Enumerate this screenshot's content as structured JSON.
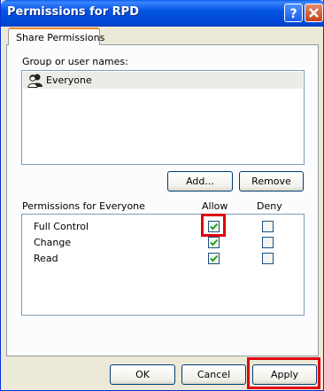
{
  "window": {
    "title": "Permissions for RPD",
    "help_icon": "question-icon",
    "close_icon": "close-icon"
  },
  "tab": {
    "label": "Share Permissions"
  },
  "group_section": {
    "label": "Group or user names:",
    "items": [
      {
        "name": "Everyone",
        "icon": "users-group-icon",
        "selected": true
      }
    ]
  },
  "buttons": {
    "add": "Add...",
    "remove": "Remove",
    "ok": "OK",
    "cancel": "Cancel",
    "apply": "Apply"
  },
  "permissions": {
    "label": "Permissions for Everyone",
    "allow_header": "Allow",
    "deny_header": "Deny",
    "rows": [
      {
        "name": "Full Control",
        "allow": true,
        "deny": false
      },
      {
        "name": "Change",
        "allow": true,
        "deny": false
      },
      {
        "name": "Read",
        "allow": true,
        "deny": false
      }
    ]
  },
  "colors": {
    "title_blue": "#0453e3",
    "highlight_red": "#e0000f",
    "check_green": "#21a121"
  }
}
